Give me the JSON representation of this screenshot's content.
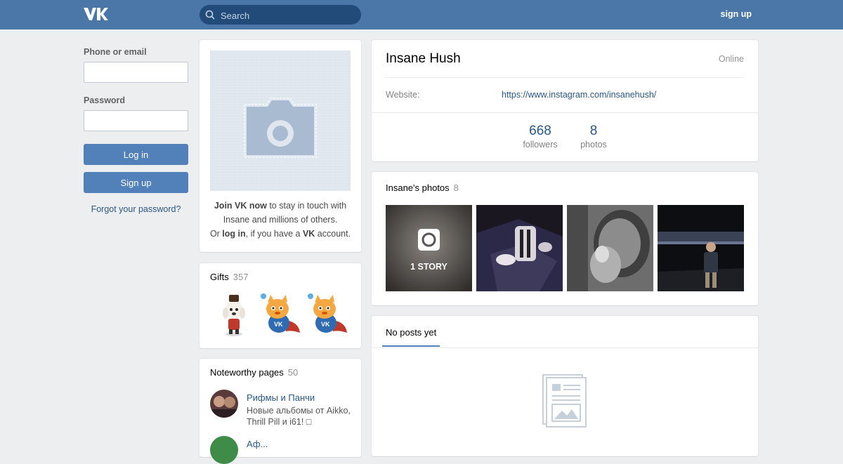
{
  "header": {
    "logo_text": "VK",
    "search_placeholder": "Search",
    "signup_label": "sign up"
  },
  "login": {
    "phone_label": "Phone or email",
    "password_label": "Password",
    "login_button": "Log in",
    "signup_button": "Sign up",
    "forgot_link": "Forgot your password?"
  },
  "avatar_card": {
    "join_bold": "Join VK now",
    "join_rest": " to stay in touch with Insane and millions of others.",
    "or": "Or ",
    "login_link": "log in",
    "mid": ", if you have a ",
    "vk": "VK",
    "end": " account."
  },
  "gifts": {
    "title": "Gifts",
    "count": "357"
  },
  "noteworthy": {
    "title": "Noteworthy pages",
    "count": "50",
    "items": [
      {
        "name": "Рифмы и Панчи",
        "desc": "Новые альбомы от Aikko, Thrill Pill и i61! □"
      },
      {
        "name": "Аф..."
      }
    ]
  },
  "profile": {
    "name": "Insane Hush",
    "status": "Online",
    "website_label": "Website:",
    "website_url": "https://www.instagram.com/insanehush/",
    "stats": [
      {
        "value": "668",
        "label": "followers"
      },
      {
        "value": "8",
        "label": "photos"
      }
    ]
  },
  "photos": {
    "title": "Insane's photos",
    "count": "8",
    "story_label": "1 STORY"
  },
  "posts": {
    "tab_label": "No posts yet"
  },
  "colors": {
    "header_bg": "#4a76a8",
    "page_bg": "#edeef0",
    "button_bg": "#5181b8",
    "link": "#2a5885"
  }
}
